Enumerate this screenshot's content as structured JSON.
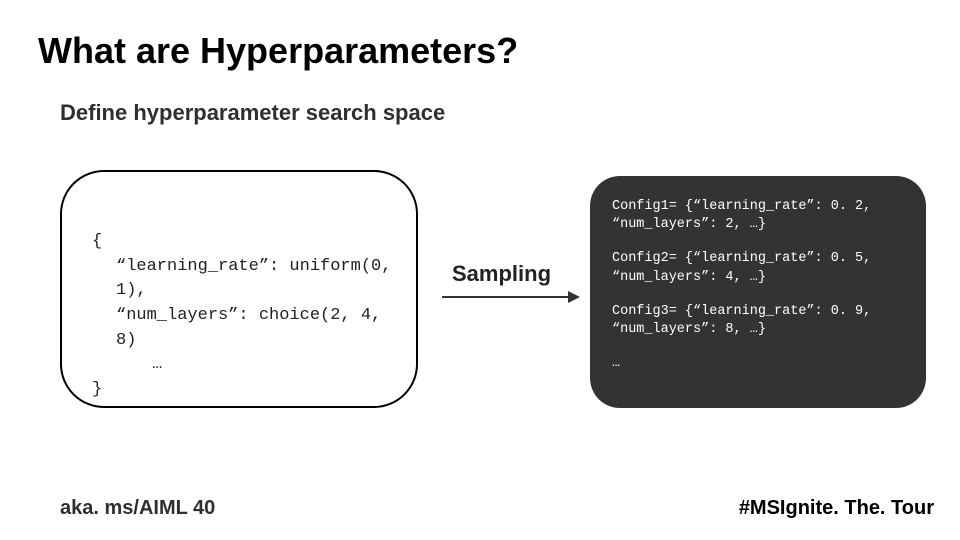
{
  "title": "What are Hyperparameters?",
  "subtitle": "Define hyperparameter search space",
  "search_space": {
    "open": "{",
    "line1": "“learning_rate”: uniform(0, 1),",
    "line2": "“num_layers”: choice(2, 4, 8)",
    "line3": "…",
    "close": "}"
  },
  "sampling_label": "Sampling",
  "configs": {
    "c1": "Config1= {“learning_rate”: 0. 2, “num_layers”: 2, …}",
    "c2": "Config2= {“learning_rate”: 0. 5, “num_layers”: 4, …}",
    "c3": "Config3= {“learning_rate”: 0. 9, “num_layers”: 8, …}",
    "more": "…"
  },
  "footer": {
    "left": "aka. ms/AIML 40",
    "right": "#MSIgnite. The. Tour"
  }
}
